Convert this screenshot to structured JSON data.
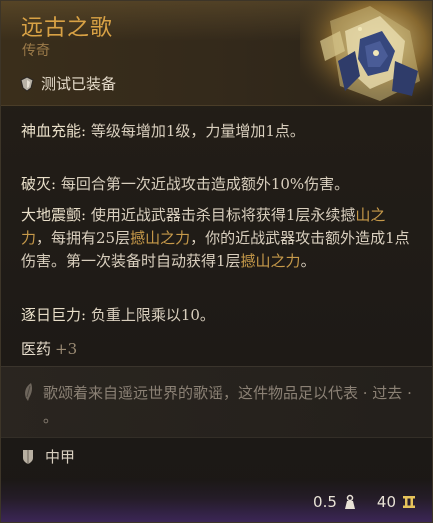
{
  "item": {
    "name": "远古之歌",
    "rarity": "传奇",
    "equip_status": "测试已装备"
  },
  "passives": [
    {
      "name": "神血充能:",
      "text": " 等级每增加1级，力量增加1点。"
    },
    {
      "name": "破灭:",
      "text": " 每回合第一次近战攻击造成额外10%伤害。"
    },
    {
      "name": "大地震颤:",
      "text_parts": [
        {
          "t": " 使用近战武器击杀目标将获得1层永续撼",
          "hl": false
        },
        {
          "t": "山之力",
          "hl": true
        },
        {
          "t": "，每拥有25层",
          "hl": false
        },
        {
          "t": "撼山之力",
          "hl": true
        },
        {
          "t": "，你的近战武器攻击额外造成1点伤害。第一次装备时自动获得1层",
          "hl": false
        },
        {
          "t": "撼山之力",
          "hl": true
        },
        {
          "t": "。",
          "hl": false
        }
      ]
    },
    {
      "name": "逐日巨力:",
      "text": " 负重上限乘以10。"
    }
  ],
  "skill": {
    "name": "医药",
    "value": "+3"
  },
  "flavor": {
    "text": "歌颂着来自遥远世界的歌谣，这件物品足以代表 · 过去 · 。"
  },
  "armor": {
    "type": "中甲"
  },
  "footer": {
    "weight": "0.5",
    "price": "40"
  },
  "colors": {
    "name": "#d9a245",
    "highlight": "#c79a4a",
    "footer_glow": "#3b2656"
  }
}
